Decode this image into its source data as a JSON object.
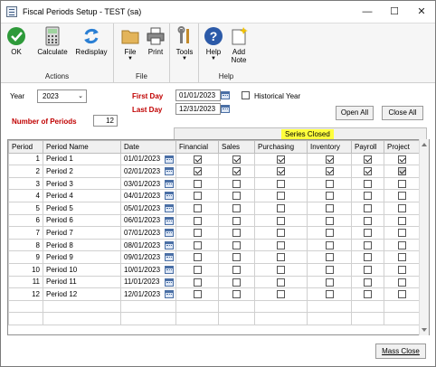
{
  "window": {
    "title": "Fiscal Periods Setup  -  TEST (sa)",
    "minimize": "—",
    "maximize": "☐",
    "close": "✕"
  },
  "ribbon": {
    "groups": [
      {
        "label": "Actions",
        "buttons": [
          "OK",
          "Calculate",
          "Redisplay"
        ]
      },
      {
        "label": "File",
        "buttons": [
          "File",
          "Print"
        ]
      },
      {
        "label": "",
        "buttons": [
          "Tools"
        ]
      },
      {
        "label": "Help",
        "buttons": [
          "Help",
          "Add Note"
        ]
      }
    ],
    "colors": {
      "ok": "#2e9a3a",
      "help": "#2c5aa8"
    }
  },
  "form": {
    "year_label": "Year",
    "year_value": "2023",
    "first_day_label": "First Day",
    "first_day_value": "01/01/2023",
    "last_day_label": "Last Day",
    "last_day_value": "12/31/2023",
    "historical_label": "Historical Year",
    "num_periods_label": "Number of Periods",
    "num_periods_value": "12",
    "open_all": "Open All",
    "close_all": "Close All",
    "series_closed": "Series Closed",
    "mass_close": "Mass Close"
  },
  "table": {
    "headers": [
      "Period",
      "Period Name",
      "Date",
      "Financial",
      "Sales",
      "Purchasing",
      "Inventory",
      "Payroll",
      "Project"
    ],
    "rows": [
      {
        "period": "1",
        "name": "Period 1",
        "date": "01/01/2023",
        "checks": [
          true,
          true,
          true,
          true,
          true,
          true
        ]
      },
      {
        "period": "2",
        "name": "Period 2",
        "date": "02/01/2023",
        "checks": [
          true,
          true,
          true,
          true,
          true,
          true
        ]
      },
      {
        "period": "3",
        "name": "Period 3",
        "date": "03/01/2023",
        "checks": [
          false,
          false,
          false,
          false,
          false,
          false
        ]
      },
      {
        "period": "4",
        "name": "Period 4",
        "date": "04/01/2023",
        "checks": [
          false,
          false,
          false,
          false,
          false,
          false
        ]
      },
      {
        "period": "5",
        "name": "Period 5",
        "date": "05/01/2023",
        "checks": [
          false,
          false,
          false,
          false,
          false,
          false
        ]
      },
      {
        "period": "6",
        "name": "Period 6",
        "date": "06/01/2023",
        "checks": [
          false,
          false,
          false,
          false,
          false,
          false
        ]
      },
      {
        "period": "7",
        "name": "Period 7",
        "date": "07/01/2023",
        "checks": [
          false,
          false,
          false,
          false,
          false,
          false
        ]
      },
      {
        "period": "8",
        "name": "Period 8",
        "date": "08/01/2023",
        "checks": [
          false,
          false,
          false,
          false,
          false,
          false
        ]
      },
      {
        "period": "9",
        "name": "Period 9",
        "date": "09/01/2023",
        "checks": [
          false,
          false,
          false,
          false,
          false,
          false
        ]
      },
      {
        "period": "10",
        "name": "Period 10",
        "date": "10/01/2023",
        "checks": [
          false,
          false,
          false,
          false,
          false,
          false
        ]
      },
      {
        "period": "11",
        "name": "Period 11",
        "date": "11/01/2023",
        "checks": [
          false,
          false,
          false,
          false,
          false,
          false
        ]
      },
      {
        "period": "12",
        "name": "Period 12",
        "date": "12/01/2023",
        "checks": [
          false,
          false,
          false,
          false,
          false,
          false
        ]
      }
    ]
  }
}
